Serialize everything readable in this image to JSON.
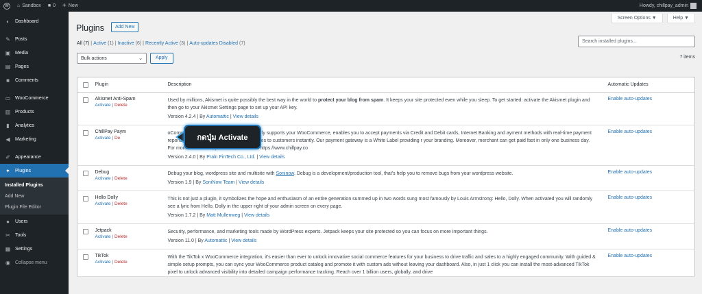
{
  "adminbar": {
    "site_name": "Sandbox",
    "comments_count": "0",
    "new_label": "New",
    "howdy": "Howdy, chillpay_admin"
  },
  "sidebar": {
    "items": [
      {
        "label": "Dashboard",
        "icon": "dashboard-icon"
      },
      {
        "label": "Posts",
        "icon": "pin-icon"
      },
      {
        "label": "Media",
        "icon": "media-icon"
      },
      {
        "label": "Pages",
        "icon": "pages-icon"
      },
      {
        "label": "Comments",
        "icon": "comment-icon"
      },
      {
        "label": "WooCommerce",
        "icon": "woo-icon"
      },
      {
        "label": "Products",
        "icon": "archive-icon"
      },
      {
        "label": "Analytics",
        "icon": "bar-chart-icon"
      },
      {
        "label": "Marketing",
        "icon": "megaphone-icon"
      },
      {
        "label": "Appearance",
        "icon": "brush-icon"
      },
      {
        "label": "Plugins",
        "icon": "plug-icon"
      },
      {
        "label": "Users",
        "icon": "user-icon"
      },
      {
        "label": "Tools",
        "icon": "wrench-icon"
      },
      {
        "label": "Settings",
        "icon": "sliders-icon"
      },
      {
        "label": "Collapse menu",
        "icon": "collapse-icon"
      }
    ],
    "submenu": [
      "Installed Plugins",
      "Add New",
      "Plugin File Editor"
    ]
  },
  "header": {
    "screen_options": "Screen Options ▼",
    "help": "Help ▼",
    "title": "Plugins",
    "add_new": "Add New"
  },
  "filters": {
    "all": "All",
    "all_count": "(7)",
    "active": "Active",
    "active_count": "(1)",
    "inactive": "Inactive",
    "inactive_count": "(6)",
    "recently_active": "Recently Active",
    "recently_active_count": "(3)",
    "auto_updates_disabled": "Auto-updates Disabled",
    "auto_updates_disabled_count": "(7)"
  },
  "search": {
    "placeholder": "Search installed plugins..."
  },
  "bulk": {
    "label": "Bulk actions",
    "apply": "Apply"
  },
  "items_count": "7 items",
  "table": {
    "headers": {
      "plugin": "Plugin",
      "description": "Description",
      "auto": "Automatic Updates"
    },
    "rows": [
      {
        "name": "Akismet Anti-Spam",
        "activate": "Activate",
        "delete": "Delete",
        "desc_pre": "Used by millions, Akismet is quite possibly the best way in the world to ",
        "desc_bold": "protect your blog from spam",
        "desc_post": ". It keeps your site protected even while you sleep. To get started: activate the Akismet plugin and then go to your Akismet Settings page to set up your API key.",
        "version": "Version 4.2.4",
        "by": "By",
        "author": "Automattic",
        "details": "View details",
        "auto": "Enable auto-updates"
      },
      {
        "name": "ChillPay Paym",
        "activate": "Activate",
        "delete": "De",
        "desc": "oCommerce payment gateway plugin primarly supports your WooCommerce, enables you to accept payments via Credit and Debit cards, Internet Banking and ayment methods with real-time payment reports to help you deliver products & services to customers instantly. Our payment gateway is a White Label providing r your branding. Moreover, merchant can get paid fast in only one business day. For more information, please see details at https://www.chillpay.co",
        "version": "Version 2.4.0",
        "by": "By",
        "author": "Praln FinTech Co., Ltd.",
        "details": "View details",
        "auto": "Enable auto-updates"
      },
      {
        "name": "Debug",
        "activate": "Activate",
        "delete": "Delete",
        "desc_pre": "Debug your blog, wordpress site and multisite with ",
        "desc_link": "Soninow",
        "desc_post": ". Debug is a development/production tool, that's help you to remove bugs from your wordpress website.",
        "version": "Version 1.9",
        "by": "By",
        "author": "SoniNow Team",
        "details": "View details",
        "auto": "Enable auto-updates"
      },
      {
        "name": "Hello Dolly",
        "activate": "Activate",
        "delete": "Delete",
        "desc": "This is not just a plugin, it symbolizes the hope and enthusiasm of an entire generation summed up in two words sung most famously by Louis Armstrong: Hello, Dolly. When activated you will randomly see a lyric from Hello, Dolly in the upper right of your admin screen on every page.",
        "version": "Version 1.7.2",
        "by": "By",
        "author": "Matt Mullenweg",
        "details": "View details",
        "auto": "Enable auto-updates"
      },
      {
        "name": "Jetpack",
        "activate": "Activate",
        "delete": "Delete",
        "desc": "Security, performance, and marketing tools made by WordPress experts. Jetpack keeps your site protected so you can focus on more important things.",
        "version": "Version 11.0",
        "by": "By",
        "author": "Automattic",
        "details": "View details",
        "auto": "Enable auto-updates"
      },
      {
        "name": "TikTok",
        "activate": "Activate",
        "delete": "Delete",
        "desc": "With the TikTok x WooCommerce integration, it's easier than ever to unlock innovative social commerce features for your business to drive traffic and sales to a highly engaged community. With guided & simple setup prompts, you can sync your WooCommerce product catalog and promote it with custom ads without leaving your dashboard. Also, in just 1 click you can install the most-advanced TikTok pixel to unlock advanced visibility into detailed campaign performance tracking. Reach over 1 billion users, globally, and drive",
        "auto": "Enable auto-updates"
      }
    ]
  },
  "callout": {
    "text": "กดปุ่ม Activate"
  }
}
